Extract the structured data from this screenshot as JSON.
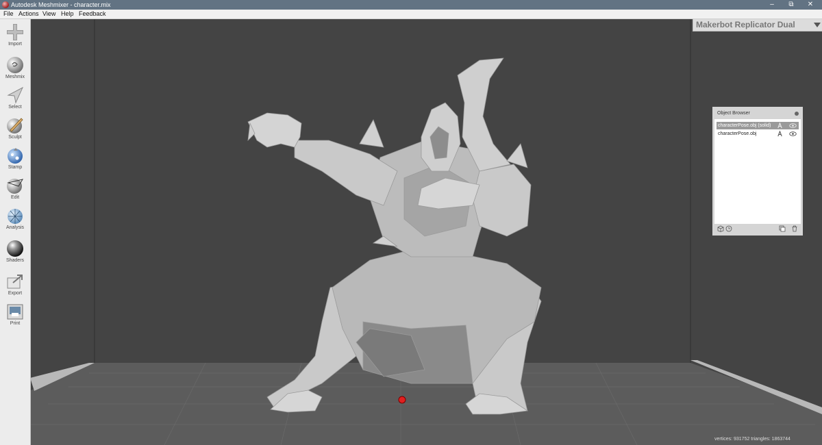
{
  "window": {
    "title": "Autodesk Meshmixer - character.mix",
    "minimize_glyph": "–",
    "maximize_glyph": "⧉",
    "close_glyph": "✕"
  },
  "menu": [
    "File",
    "Actions",
    "View",
    "Help",
    "Feedback"
  ],
  "toolbar": [
    {
      "label": "Import",
      "icon": "plus-icon"
    },
    {
      "label": "Meshmix",
      "icon": "meshmix-sphere-icon"
    },
    {
      "label": "Select",
      "icon": "select-arrow-icon"
    },
    {
      "label": "Sculpt",
      "icon": "sculpt-brush-icon"
    },
    {
      "label": "Stamp",
      "icon": "stamp-icon"
    },
    {
      "label": "Edit",
      "icon": "edit-sphere-icon"
    },
    {
      "label": "Analysis",
      "icon": "analysis-sphere-icon"
    },
    {
      "label": "Shaders",
      "icon": "shaders-sphere-icon"
    },
    {
      "label": "Export",
      "icon": "export-icon"
    },
    {
      "label": "Print",
      "icon": "print-icon"
    }
  ],
  "printer": {
    "name": "Makerbot Replicator Dual"
  },
  "object_browser": {
    "title": "Object Browser",
    "items": [
      {
        "name": "characterPose.obj (solid)",
        "selected": true
      },
      {
        "name": "characterPose.obj",
        "selected": false
      }
    ]
  },
  "status": {
    "text": "vertices: 931752 triangles: 1863744"
  },
  "colors": {
    "titlebar": "#627383",
    "viewport_bg": "#444444",
    "platform": "#5c5c5c",
    "model": "#c8c8c8",
    "selected_row": "#9a9a9a",
    "origin_marker": "#e02020"
  }
}
